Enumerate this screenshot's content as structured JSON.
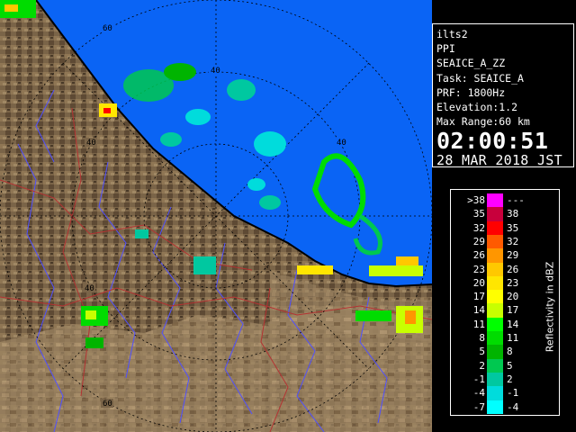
{
  "info": {
    "lines": [
      "ilts2",
      "PPI",
      "SEAICE_A_ZZ",
      "Task: SEAICE_A",
      "PRF: 1800Hz",
      "Elevation:1.2",
      "Max Range:60 km"
    ],
    "time": "02:00:51",
    "date": "28 MAR 2018 JST"
  },
  "range_labels": [
    "60",
    "40",
    "40",
    "40",
    "40",
    "60"
  ],
  "legend": {
    "caption": "Reflectivity in dBZ",
    "rows": [
      {
        "low": ">38",
        "high": "---",
        "color": "#ff00ff"
      },
      {
        "low": "35",
        "high": "38",
        "color": "#c8003c"
      },
      {
        "low": "32",
        "high": "35",
        "color": "#ff0000"
      },
      {
        "low": "29",
        "high": "32",
        "color": "#ff5a00"
      },
      {
        "low": "26",
        "high": "29",
        "color": "#ff9600"
      },
      {
        "low": "23",
        "high": "26",
        "color": "#ffc800"
      },
      {
        "low": "20",
        "high": "23",
        "color": "#ffe600"
      },
      {
        "low": "17",
        "high": "20",
        "color": "#ffff00"
      },
      {
        "low": "14",
        "high": "17",
        "color": "#c8ff00"
      },
      {
        "low": "11",
        "high": "14",
        "color": "#00ff00"
      },
      {
        "low": "8",
        "high": "11",
        "color": "#00dc00"
      },
      {
        "low": "5",
        "high": "8",
        "color": "#00b400"
      },
      {
        "low": "2",
        "high": "5",
        "color": "#00c850"
      },
      {
        "low": "-1",
        "high": "2",
        "color": "#00c8a0"
      },
      {
        "low": "-4",
        "high": "-1",
        "color": "#00dcdc"
      },
      {
        "low": "-7",
        "high": "-4",
        "color": "#00ffff"
      }
    ]
  },
  "colors": {
    "sea": "#0a64f5",
    "land": "#7a6448",
    "rivers": "#5050ff",
    "boundaries": "#b43232",
    "range_rings": "#000000"
  }
}
